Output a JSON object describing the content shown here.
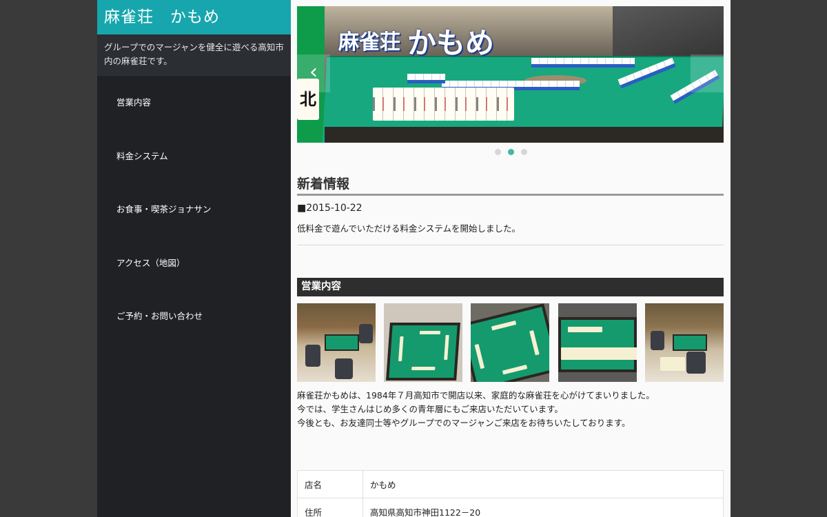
{
  "site": {
    "title": "麻雀荘　かもめ",
    "description": "グループでのマージャンを健全に遊べる高知市内の麻雀荘です。"
  },
  "nav": {
    "items": [
      {
        "label": "営業内容"
      },
      {
        "label": "料金システム"
      },
      {
        "label": "お食事・喫茶ジョナサン"
      },
      {
        "label": "アクセス（地図）"
      },
      {
        "label": "ご予約・お問い合わせ"
      }
    ]
  },
  "hero": {
    "title_small": "麻雀荘",
    "title_big": "かもめ",
    "tile_char": "北",
    "prev_label": "‹",
    "slides_total": 3,
    "active_slide": 2
  },
  "news": {
    "heading": "新着情報",
    "items": [
      {
        "date": "■2015-10-22",
        "text": "低料金で遊んでいただける料金システムを開始しました。"
      }
    ]
  },
  "business": {
    "heading": "営業内容",
    "thumbnails": [
      "mahjong-room-photo",
      "mahjong-table-photo",
      "mahjong-table-closeup-photo",
      "mahjong-tiles-photo",
      "mahjong-room-photo-2"
    ],
    "about_lines": [
      "麻雀荘かもめは、1984年７月高知市で開店以来、家庭的な麻雀荘を心がけてまいりました。",
      "今では、学生さんはじめ多くの青年層にもご来店いただいています。",
      "今後とも、お友達同士等やグループでのマージャンご来店をお待ちいたしております。"
    ]
  },
  "info": {
    "rows": [
      {
        "key": "店名",
        "value": "かもめ"
      },
      {
        "key": "住所",
        "value": "高知県高知市神田1122－20"
      }
    ]
  },
  "colors": {
    "accent": "#17a6ad",
    "sidebar_bg": "#1f2124",
    "section_header_bg": "#2e2e2e",
    "dot_active": "#47b6a3"
  }
}
